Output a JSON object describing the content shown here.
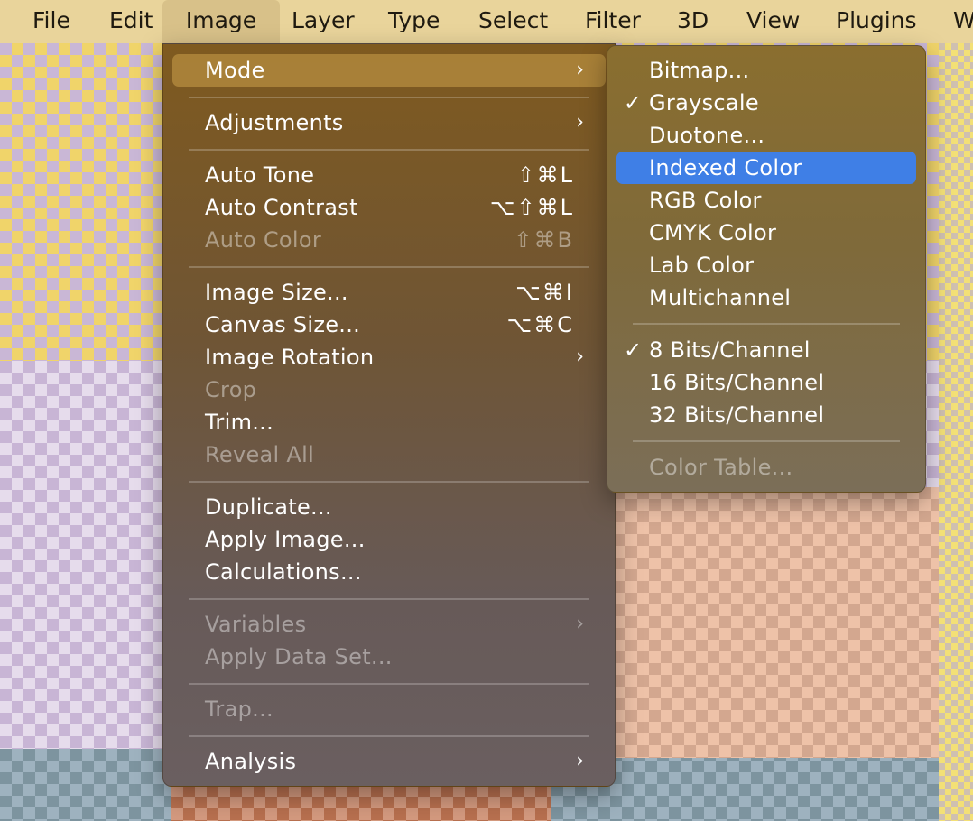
{
  "menubar": {
    "items": [
      "File",
      "Edit",
      "Image",
      "Layer",
      "Type",
      "Select",
      "Filter",
      "3D",
      "View",
      "Plugins",
      "W"
    ],
    "active": "Image"
  },
  "image_menu": {
    "mode": "Mode",
    "adjustments": "Adjustments",
    "auto_tone": "Auto Tone",
    "auto_tone_shortcut": "⇧⌘L",
    "auto_contrast": "Auto Contrast",
    "auto_contrast_shortcut": "⌥⇧⌘L",
    "auto_color": "Auto Color",
    "auto_color_shortcut": "⇧⌘B",
    "image_size": "Image Size...",
    "image_size_shortcut": "⌥⌘I",
    "canvas_size": "Canvas Size...",
    "canvas_size_shortcut": "⌥⌘C",
    "image_rotation": "Image Rotation",
    "crop": "Crop",
    "trim": "Trim...",
    "reveal_all": "Reveal All",
    "duplicate": "Duplicate...",
    "apply_image": "Apply Image...",
    "calculations": "Calculations...",
    "variables": "Variables",
    "apply_data_set": "Apply Data Set...",
    "trap": "Trap...",
    "analysis": "Analysis",
    "arrow": "›"
  },
  "mode_submenu": {
    "bitmap": "Bitmap...",
    "grayscale": "Grayscale",
    "duotone": "Duotone...",
    "indexed_color": "Indexed Color",
    "rgb_color": "RGB Color",
    "cmyk_color": "CMYK Color",
    "lab_color": "Lab Color",
    "multichannel": "Multichannel",
    "bits8": "8 Bits/Channel",
    "bits16": "16 Bits/Channel",
    "bits32": "32 Bits/Channel",
    "color_table": "Color Table...",
    "check": "✓"
  },
  "colors": {
    "highlight": "#3f7fe6",
    "menubar": "#e9d49b"
  }
}
